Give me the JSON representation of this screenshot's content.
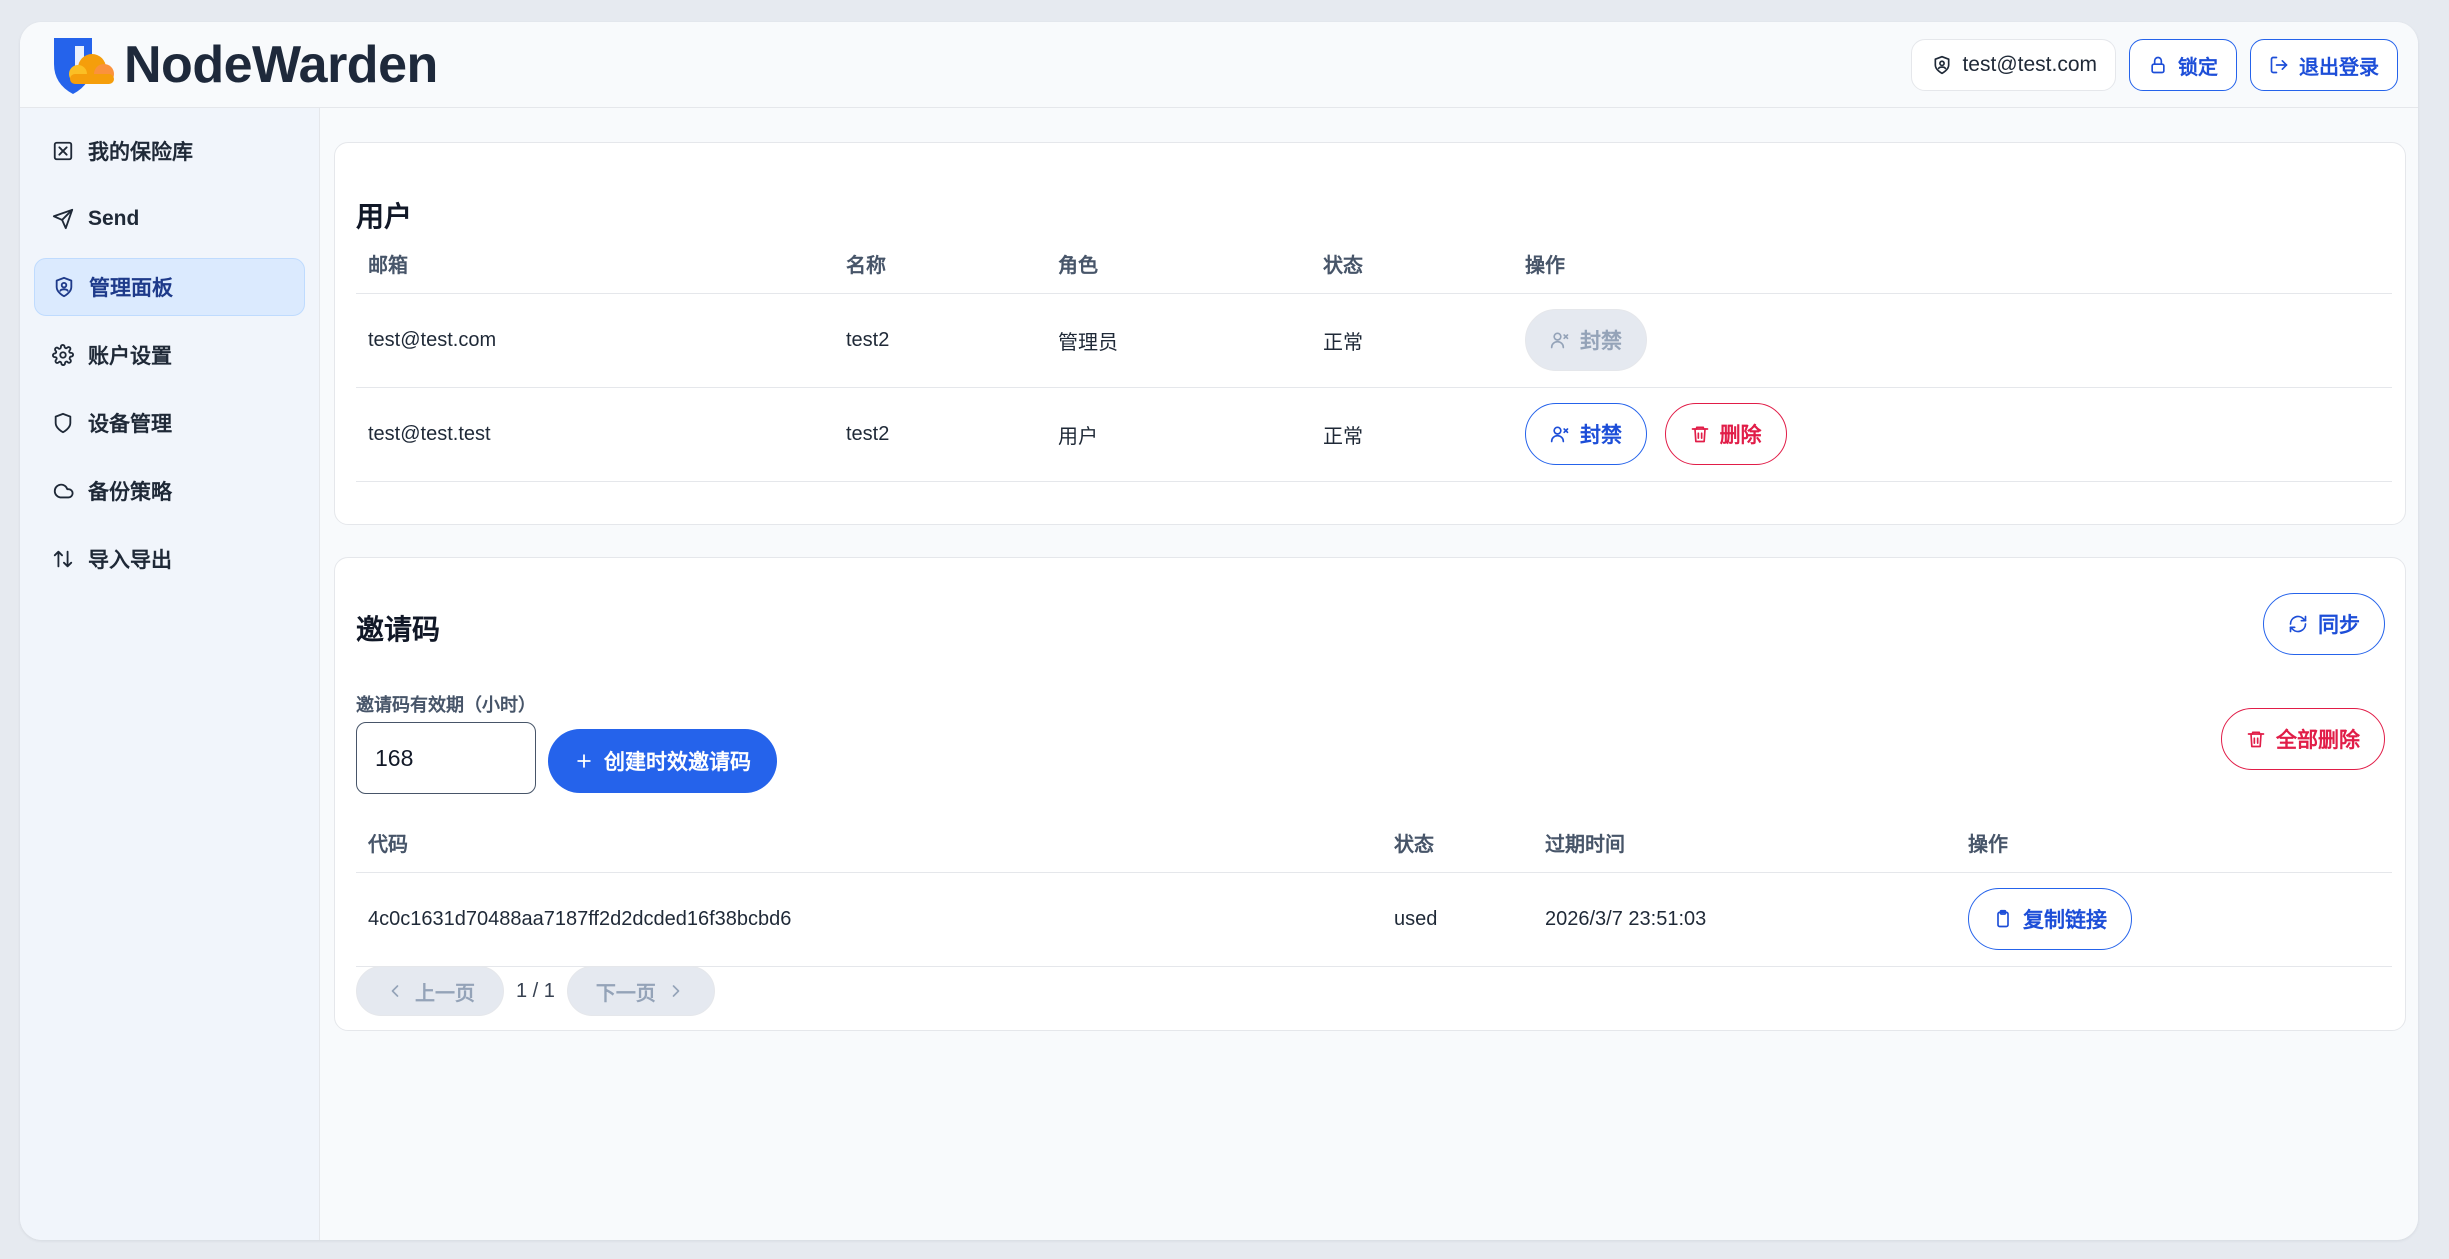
{
  "brand": {
    "name": "NodeWarden"
  },
  "header": {
    "user_email": "test@test.com",
    "lock_label": "锁定",
    "logout_label": "退出登录"
  },
  "sidebar": {
    "items": [
      {
        "label": "我的保险库",
        "icon": "vault-icon"
      },
      {
        "label": "Send",
        "icon": "send-icon"
      },
      {
        "label": "管理面板",
        "icon": "shield-user-icon",
        "active": true
      },
      {
        "label": "账户设置",
        "icon": "gear-icon"
      },
      {
        "label": "设备管理",
        "icon": "shield-icon"
      },
      {
        "label": "备份策略",
        "icon": "cloud-icon"
      },
      {
        "label": "导入导出",
        "icon": "arrows-updown-icon"
      }
    ]
  },
  "users": {
    "title": "用户",
    "columns": [
      "邮箱",
      "名称",
      "角色",
      "状态",
      "操作"
    ],
    "rows": [
      {
        "email": "test@test.com",
        "name": "test2",
        "role": "管理员",
        "status": "正常",
        "ban_label": "封禁"
      },
      {
        "email": "test@test.test",
        "name": "test2",
        "role": "用户",
        "status": "正常",
        "ban_label": "封禁",
        "delete_label": "删除"
      }
    ]
  },
  "invites": {
    "title": "邀请码",
    "sync_label": "同步",
    "expiry_label": "邀请码有效期（小时）",
    "expiry_value": "168",
    "create_label": "创建时效邀请码",
    "delete_all_label": "全部删除",
    "columns": [
      "代码",
      "状态",
      "过期时间",
      "操作"
    ],
    "rows": [
      {
        "code": "4c0c1631d70488aa7187ff2d2dcded16f38bcbd6",
        "status": "used",
        "expires": "2026/3/7 23:51:03",
        "copy_label": "复制链接"
      }
    ],
    "pager": {
      "prev_label": "上一页",
      "page_text": "1 / 1",
      "next_label": "下一页"
    }
  },
  "colors": {
    "accent": "#2563eb",
    "danger": "#e11d48",
    "brand_shield": "#2563eb",
    "brand_cloud": "#f59e0b"
  }
}
